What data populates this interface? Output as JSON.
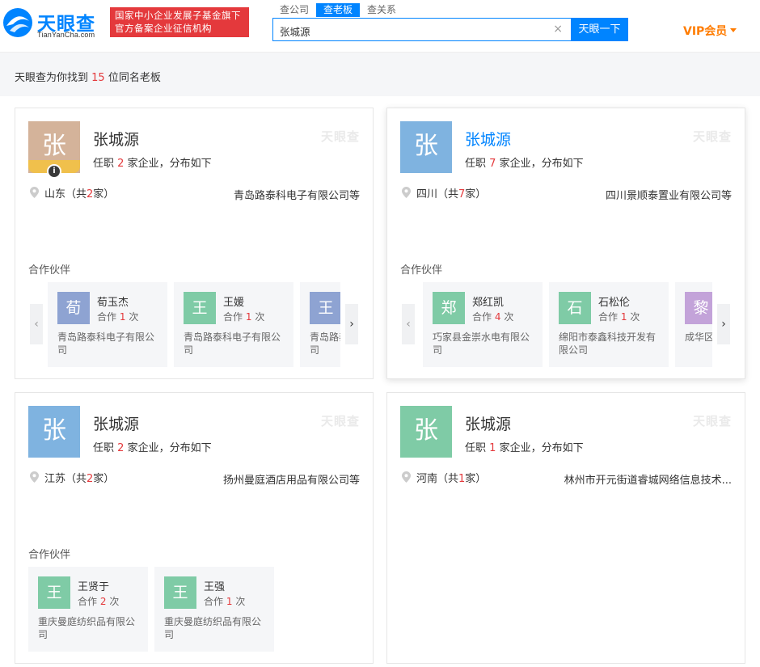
{
  "header": {
    "logo_text": "天眼查",
    "logo_sub": "TianYanCha.com",
    "slogan_line1": "国家中小企业发展子基金旗下",
    "slogan_line2": "官方备案企业征信机构",
    "tabs": [
      {
        "label": "查公司",
        "active": false
      },
      {
        "label": "查老板",
        "active": true
      },
      {
        "label": "查关系",
        "active": false
      }
    ],
    "search_value": "张城源",
    "clear_icon": "×",
    "search_button": "天眼一下",
    "vip_label": "VIP会员"
  },
  "result": {
    "prefix": "天眼查为你找到",
    "count": "15",
    "suffix": "位同名老板"
  },
  "watermark": "天眼查",
  "partners_title": "合作伙伴",
  "cards": [
    {
      "avatar_char": "张",
      "avatar_color": "#d4b39a",
      "name": "张城源",
      "job_prefix": "任职",
      "job_count": "2",
      "job_suffix": "家企业，分布如下",
      "loc_prefix": "山东（共",
      "loc_count": "2",
      "loc_suffix": "家）",
      "firm": "青岛路泰科电子有限公司等",
      "partners": [
        {
          "char": "荀",
          "color": "#8ea3d2",
          "name": "荀玉杰",
          "coop_prefix": "合作",
          "coop_count": "1",
          "coop_suffix": "次",
          "firm": "青岛路泰科电子有限公司"
        },
        {
          "char": "王",
          "color": "#7fcba6",
          "name": "王媛",
          "coop_prefix": "合作",
          "coop_count": "1",
          "coop_suffix": "次",
          "firm": "青岛路泰科电子有限公司"
        },
        {
          "char": "王",
          "color": "#8ea3d2",
          "name": "",
          "coop_prefix": "",
          "coop_count": "",
          "coop_suffix": "",
          "firm": "青岛路泰科电子有限公司"
        }
      ]
    },
    {
      "avatar_char": "张",
      "avatar_color": "#7fb3e0",
      "name": "张城源",
      "job_prefix": "任职",
      "job_count": "7",
      "job_suffix": "家企业，分布如下",
      "loc_prefix": "四川（共",
      "loc_count": "7",
      "loc_suffix": "家）",
      "firm": "四川景顺泰置业有限公司等",
      "partners": [
        {
          "char": "郑",
          "color": "#7fcba6",
          "name": "郑红凯",
          "coop_prefix": "合作",
          "coop_count": "4",
          "coop_suffix": "次",
          "firm": "巧家县金崇水电有限公司"
        },
        {
          "char": "石",
          "color": "#7fcba6",
          "name": "石松伦",
          "coop_prefix": "合作",
          "coop_count": "1",
          "coop_suffix": "次",
          "firm": "绵阳市泰鑫科技开发有限公司"
        },
        {
          "char": "黎",
          "color": "#c3a3d9",
          "name": "",
          "coop_prefix": "",
          "coop_count": "",
          "coop_suffix": "",
          "firm": "成华区"
        }
      ]
    },
    {
      "avatar_char": "张",
      "avatar_color": "#7fb3e0",
      "name": "张城源",
      "job_prefix": "任职",
      "job_count": "2",
      "job_suffix": "家企业，分布如下",
      "loc_prefix": "江苏（共",
      "loc_count": "2",
      "loc_suffix": "家）",
      "firm": "扬州曼庭酒店用品有限公司等",
      "partners": [
        {
          "char": "王",
          "color": "#7fcba6",
          "name": "王贤于",
          "coop_prefix": "合作",
          "coop_count": "2",
          "coop_suffix": "次",
          "firm": "重庆曼庭纺织品有限公司"
        },
        {
          "char": "王",
          "color": "#7fcba6",
          "name": "王强",
          "coop_prefix": "合作",
          "coop_count": "1",
          "coop_suffix": "次",
          "firm": "重庆曼庭纺织品有限公司"
        }
      ]
    },
    {
      "avatar_char": "张",
      "avatar_color": "#7fcba6",
      "name": "张城源",
      "job_prefix": "任职",
      "job_count": "1",
      "job_suffix": "家企业，分布如下",
      "loc_prefix": "河南（共",
      "loc_count": "1",
      "loc_suffix": "家）",
      "firm": "林州市开元街道睿城网络信息技术...",
      "partners": []
    }
  ]
}
